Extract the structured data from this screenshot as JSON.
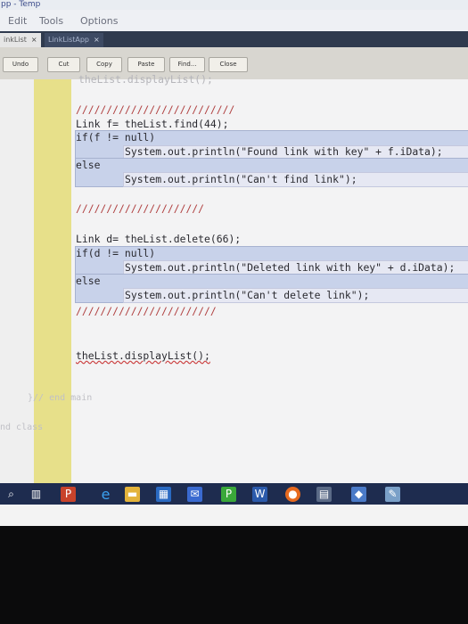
{
  "window": {
    "title_fragment": "pp - Temp"
  },
  "menu": [
    "Edit",
    "Tools",
    "Options"
  ],
  "tabs": [
    {
      "label": "inkList",
      "close": "×",
      "active": true
    },
    {
      "label": "LinkListApp",
      "close": "×",
      "active": false
    }
  ],
  "toolbar": [
    "Undo",
    "Cut",
    "Copy",
    "Paste",
    "Find...",
    "Close"
  ],
  "code": {
    "top_partial": "theList.displayList();",
    "sep1": "//////////////////////////",
    "line_find": "Link f= theList.find(44);",
    "line_if_f": "if(f != null)",
    "line_print_found": "System.out.println(\"Found link with key\" + f.iData);",
    "line_else1": "else",
    "line_print_cant_find": "System.out.println(\"Can't find link\");",
    "sep2": "/////////////////////",
    "line_delete": "Link d= theList.delete(66);",
    "line_if_d": "if(d != null)",
    "line_print_deleted": "System.out.println(\"Deleted link with key\" + d.iData);",
    "line_else2": "else",
    "line_print_cant_delete": "System.out.println(\"Can't delete link\");",
    "sep3": "///////////////////////",
    "line_display": "theList.displayList();",
    "end_main": "}// end main",
    "end_class": "nd class"
  },
  "taskbar": {
    "icons": [
      "search-icon",
      "task-view-icon",
      "powerpoint-icon",
      "edge-icon",
      "file-explorer-icon",
      "store-icon",
      "mail-icon",
      "project-icon",
      "word-icon",
      "firefox-icon",
      "calculator-icon",
      "app-icon",
      "bluej-icon"
    ]
  }
}
